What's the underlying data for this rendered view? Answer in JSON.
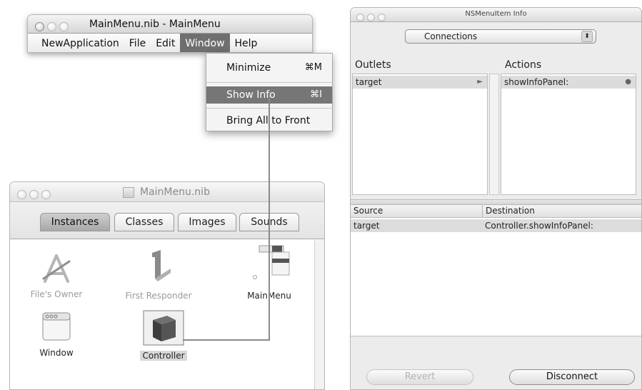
{
  "menu_window": {
    "title": "MainMenu.nib - MainMenu",
    "menus": [
      "NewApplication",
      "File",
      "Edit",
      "Window",
      "Help"
    ],
    "active_menu": "Window"
  },
  "window_menu": {
    "items": [
      {
        "label": "Minimize",
        "shortcut": "⌘M"
      },
      {
        "label": "Show Info",
        "shortcut": "⌘I"
      },
      {
        "label": "Bring All to Front",
        "shortcut": ""
      }
    ],
    "highlighted": "Show Info"
  },
  "nib_window": {
    "title": "MainMenu.nib",
    "tabs": [
      "Instances",
      "Classes",
      "Images",
      "Sounds"
    ],
    "selected_tab": "Instances",
    "objects": [
      "File's Owner",
      "First Responder",
      "MainMenu",
      "Window",
      "Controller"
    ],
    "selected_object": "Controller"
  },
  "info_panel": {
    "title": "NSMenuItem Info",
    "popup_value": "Connections",
    "outlets_header": "Outlets",
    "actions_header": "Actions",
    "outlets": [
      "target"
    ],
    "actions": [
      "showInfoPanel:"
    ],
    "source_header": "Source",
    "destination_header": "Destination",
    "connections": [
      {
        "source": "target",
        "destination": "Controller.showInfoPanel:"
      }
    ],
    "revert_label": "Revert",
    "disconnect_label": "Disconnect"
  },
  "colors": {
    "menu_highlight": "#6f6f6f",
    "row_selected": "#dcdcdc"
  }
}
